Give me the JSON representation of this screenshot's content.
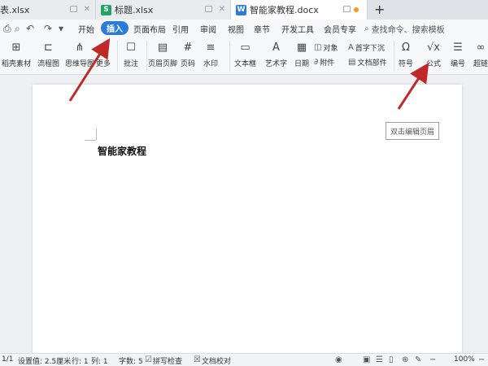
{
  "tabs": [
    {
      "label": "表.xlsx",
      "icon": "excel-icon"
    },
    {
      "label": "标题.xlsx",
      "icon": "excel-icon",
      "icon_letter": "S"
    },
    {
      "label": "智能家教程.docx",
      "icon": "word-icon",
      "icon_letter": "W"
    }
  ],
  "menu": [
    "开始",
    "插入",
    "页面布局",
    "引用",
    "审阅",
    "视图",
    "章节",
    "开发工具",
    "会员专享"
  ],
  "active_menu": "插入",
  "search_placeholder": "查找命令、搜索模板",
  "ribbon": {
    "buttons": [
      "稻壳素材",
      "流程图",
      "思维导图",
      "更多",
      "批注",
      "页眉页脚",
      "页码",
      "水印",
      "文本框",
      "艺术字",
      "日期",
      "符号",
      "公式",
      "编号",
      "超链"
    ],
    "small": [
      "对象",
      "首字下沉",
      "附件",
      "文档部件"
    ]
  },
  "document": {
    "title": "智能家教程",
    "header_hint": "双击编辑页眉"
  },
  "status": {
    "page": "1/1",
    "setting": "设置值: 2.5厘米",
    "row": "行: 1",
    "col": "列: 1",
    "words": "字数: 5",
    "spell": "拼写检查",
    "proof": "文档校对",
    "zoom": "100%"
  },
  "colors": {
    "accent": "#2b7cd8",
    "arrow": "#c0282a",
    "excel": "#1fa463",
    "word": "#2b7cd8"
  }
}
